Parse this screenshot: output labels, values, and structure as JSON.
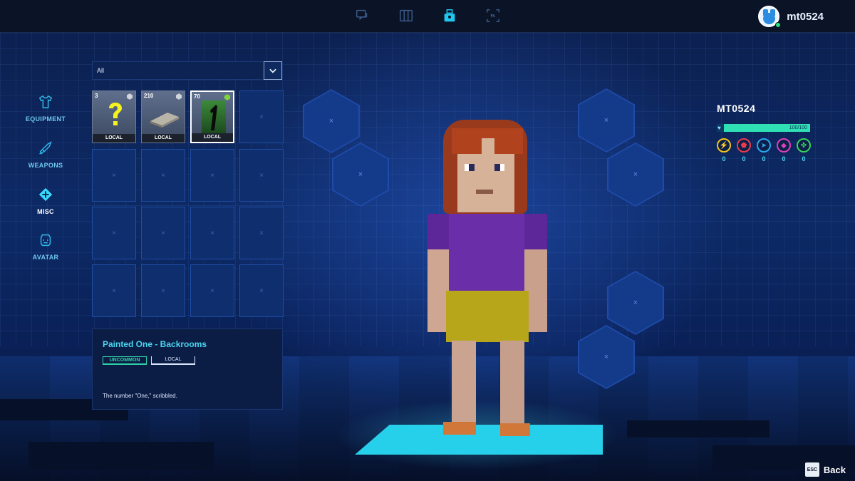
{
  "topbar": {
    "nav_icons": [
      "chat-icon",
      "map-icon",
      "inventory-icon",
      "profile-card-icon"
    ],
    "active_icon": "inventory-icon",
    "username": "mt0524"
  },
  "categories": [
    {
      "label": "EQUIPMENT",
      "icon": "shirt-icon"
    },
    {
      "label": "WEAPONS",
      "icon": "sword-icon"
    },
    {
      "label": "MISC",
      "icon": "misc-icon",
      "active": true
    },
    {
      "label": "AVATAR",
      "icon": "avatar-icon"
    }
  ],
  "filter": {
    "value": "All"
  },
  "inventory": {
    "items": [
      {
        "count": "3",
        "tag": "LOCAL",
        "art": "question-mark",
        "gem_color": "#d0d4dc"
      },
      {
        "count": "210",
        "tag": "LOCAL",
        "art": "floor-tile",
        "gem_color": "#d0d4dc"
      },
      {
        "count": "70",
        "tag": "LOCAL",
        "art": "number-one",
        "gem_color": "#7fd63a",
        "selected": true
      }
    ],
    "empty_slot_symbol": "×",
    "total_slots": 16
  },
  "details": {
    "title": "Painted One - Backrooms",
    "rarity": "UNCOMMON",
    "source": "LOCAL",
    "description": "The number \"One,\" scribbled."
  },
  "equip_slot_symbol": "×",
  "player": {
    "name": "MT0524",
    "health_text": "100/100",
    "health_fraction": 1.0,
    "stats": [
      {
        "icon": "lightning-icon",
        "color": "#f5c518",
        "value": "0"
      },
      {
        "icon": "shield-icon",
        "color": "#ef3a4a",
        "value": "0"
      },
      {
        "icon": "boot-icon",
        "color": "#2aa8f0",
        "value": "0"
      },
      {
        "icon": "potion-icon",
        "color": "#e040b8",
        "value": "0"
      },
      {
        "icon": "clover-icon",
        "color": "#35d45a",
        "value": "0"
      }
    ]
  },
  "back": {
    "key": "ESC",
    "label": "Back"
  }
}
